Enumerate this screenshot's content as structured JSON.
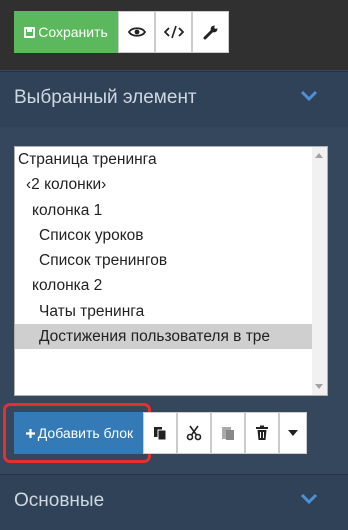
{
  "toolbar": {
    "save_label": "Сохранить",
    "icons": [
      "save-icon",
      "eye-icon",
      "code-icon",
      "wrench-icon"
    ]
  },
  "selected_panel": {
    "title": "Выбранный элемент",
    "tree": [
      "Страница тренинга",
      "‹2 колонки›",
      "колонка 1",
      "Список уроков",
      "Список тренингов",
      "колонка 2",
      "Чаты тренинга",
      "Достижения пользователя в тре"
    ],
    "selected_index": 7
  },
  "actions": {
    "add_block_label": "Добавить блок",
    "icons": [
      "copy-icon",
      "cut-icon",
      "paste-icon",
      "trash-icon",
      "caret-down-icon"
    ]
  },
  "basic_panel": {
    "title": "Основные"
  },
  "colors": {
    "save": "#5cb85c",
    "primary": "#337ab7",
    "panel": "#2f4257",
    "highlight": "#e5302c"
  }
}
